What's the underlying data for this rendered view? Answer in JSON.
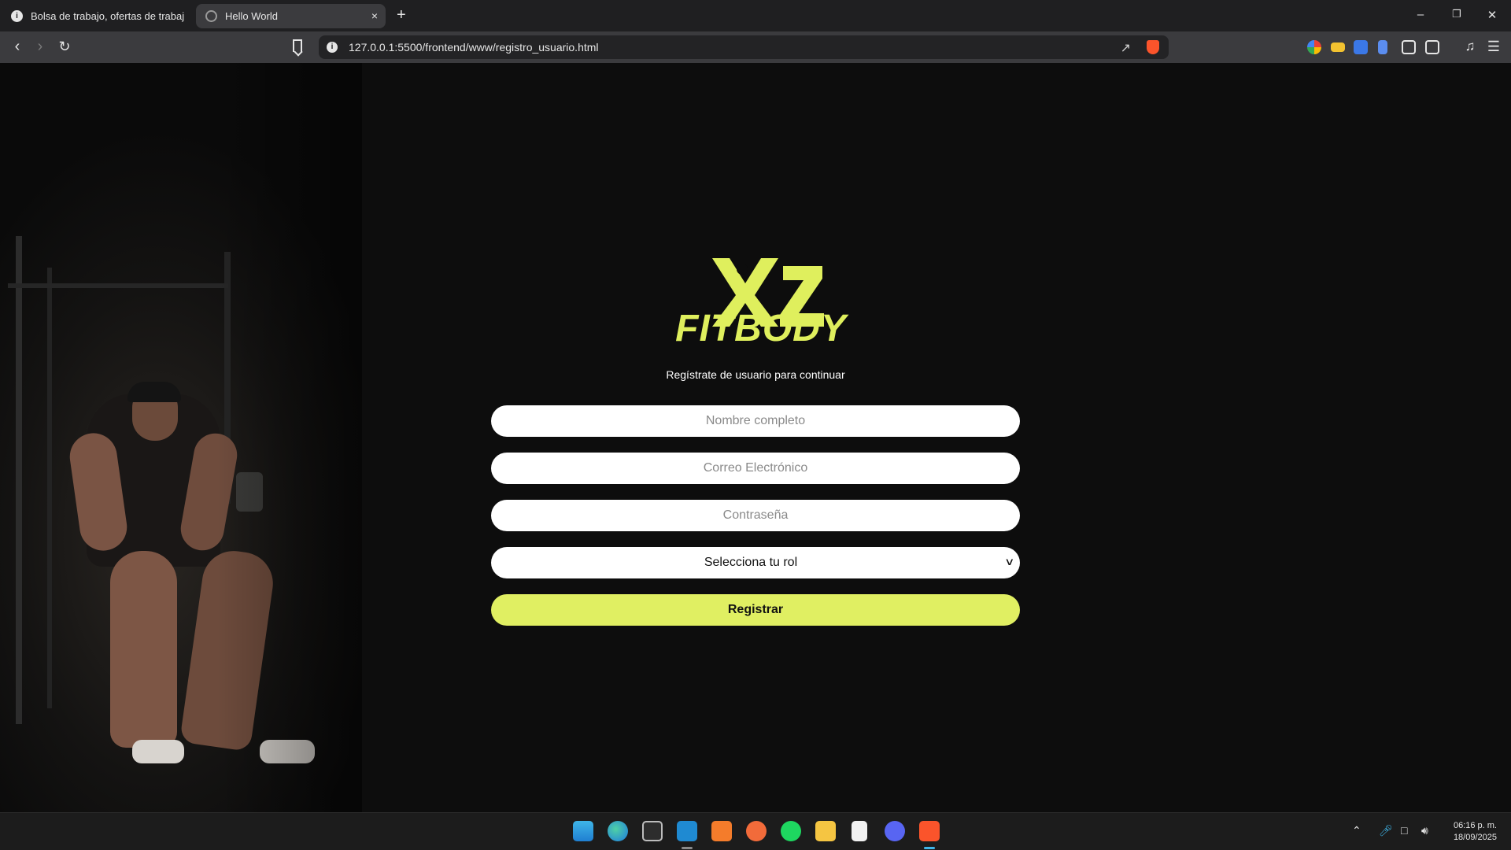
{
  "browser": {
    "tabs": [
      {
        "title": "Bolsa de trabajo, ofertas de trabajo | Computrabajo",
        "active": false
      },
      {
        "title": "Hello World",
        "active": true
      }
    ],
    "new_tab_label": "+",
    "close_label": "×",
    "url": "127.0.0.1:5500/frontend/www/registro_usuario.html",
    "window_controls": {
      "minimize": "–",
      "restore": "❐",
      "close": "✕"
    }
  },
  "page": {
    "brand": "FITBODY",
    "subtitle": "Regístrate de usuario para continuar",
    "form": {
      "name_placeholder": "Nombre completo",
      "email_placeholder": "Correo Electrónico",
      "password_placeholder": "Contraseña",
      "role_selected": "Selecciona tu rol",
      "submit_label": "Registrar"
    },
    "colors": {
      "accent": "#dfef5d",
      "background": "#0d0d0d",
      "field": "#ffffff"
    }
  },
  "taskbar": {
    "apps": [
      "windows-start-icon",
      "edge-icon",
      "terminal-icon",
      "vscode-icon",
      "xampp-icon",
      "postman-icon",
      "spotify-icon",
      "file-explorer-icon",
      "notepad-icon",
      "discord-icon",
      "brave-icon"
    ],
    "time": "06:16 p. m.",
    "date": "18/09/2025"
  }
}
